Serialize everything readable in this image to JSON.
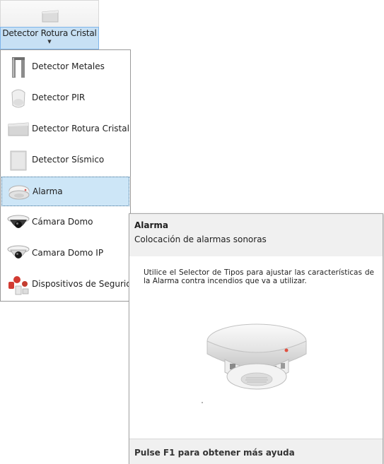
{
  "ribbon": {
    "button_label": "Detector Rotura Cristal",
    "icon": "glass-break-detector-icon"
  },
  "menu": {
    "items": [
      {
        "label": "Detector Metales",
        "icon": "metal-detector-icon"
      },
      {
        "label": "Detector PIR",
        "icon": "pir-detector-icon"
      },
      {
        "label": "Detector Rotura Cristal",
        "icon": "glass-break-detector-icon"
      },
      {
        "label": "Detector Sísmico",
        "icon": "seismic-detector-icon"
      },
      {
        "label": "Alarma",
        "icon": "smoke-alarm-icon",
        "selected": true
      },
      {
        "label": "Cámara Domo",
        "icon": "dome-camera-icon"
      },
      {
        "label": "Camara Domo IP",
        "icon": "ip-dome-camera-icon"
      },
      {
        "label": "Dispositivos de Seguridad",
        "icon": "security-devices-icon"
      }
    ]
  },
  "tooltip": {
    "title": "Alarma",
    "subtitle": "Colocación de alarmas sonoras",
    "body": "Utilice el Selector de Tipos para ajustar las características de la Alarma contra incendios que va a utilizar.",
    "image": "smoke-alarm-image",
    "footer": "Pulse F1 para obtener más ayuda"
  }
}
